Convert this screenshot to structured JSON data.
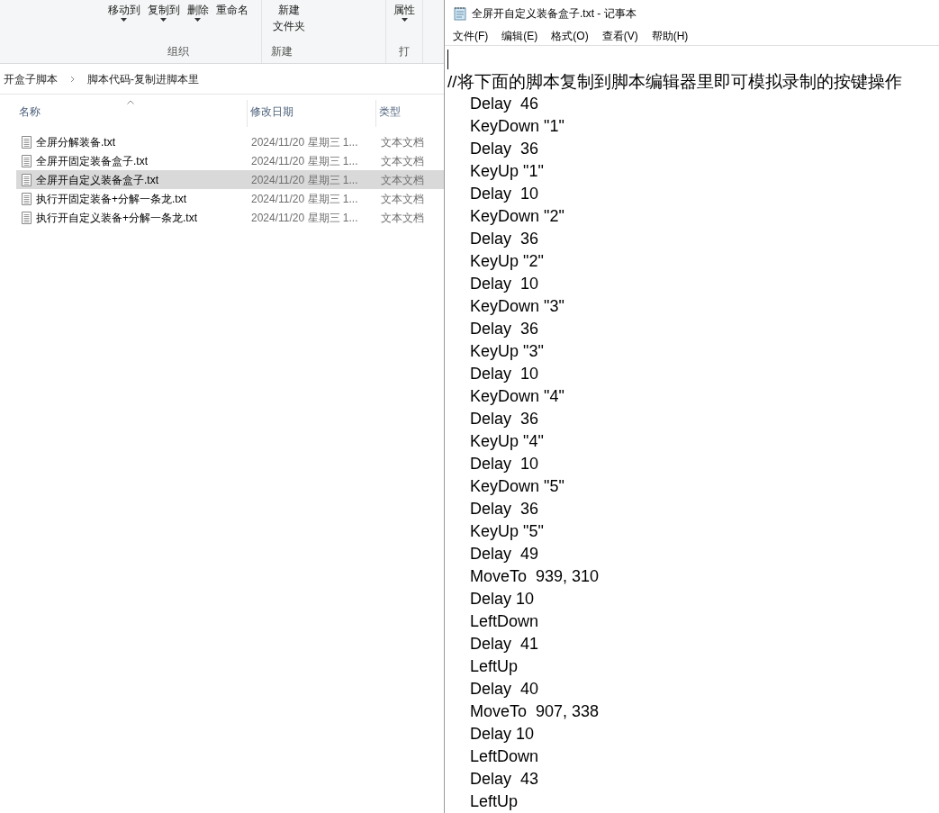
{
  "ribbon": {
    "groups": [
      {
        "label": "组织",
        "buttons": [
          {
            "label": "移动到",
            "dropdown": true
          },
          {
            "label": "复制到",
            "dropdown": true
          },
          {
            "label": "删除",
            "dropdown": true
          },
          {
            "label": "重命名",
            "dropdown": false
          }
        ]
      },
      {
        "label": "新建",
        "buttons": [
          {
            "label": [
              "新建",
              "文件夹"
            ],
            "dropdown": false
          }
        ]
      },
      {
        "label": "打",
        "buttons": [
          {
            "label": "属性",
            "dropdown": true
          }
        ]
      }
    ]
  },
  "breadcrumb": [
    "开盒子脚本",
    "脚本代码-复制进脚本里"
  ],
  "table": {
    "columns": [
      "名称",
      "修改日期",
      "类型"
    ],
    "rows": [
      {
        "name": "全屏分解装备.txt",
        "date": "2024/11/20 星期三 1...",
        "type": "文本文档",
        "selected": false
      },
      {
        "name": "全屏开固定装备盒子.txt",
        "date": "2024/11/20 星期三 1...",
        "type": "文本文档",
        "selected": false
      },
      {
        "name": "全屏开自定义装备盒子.txt",
        "date": "2024/11/20 星期三 1...",
        "type": "文本文档",
        "selected": true
      },
      {
        "name": "执行开固定装备+分解一条龙.txt",
        "date": "2024/11/20 星期三 1...",
        "type": "文本文档",
        "selected": false
      },
      {
        "name": "执行开自定义装备+分解一条龙.txt",
        "date": "2024/11/20 星期三 1...",
        "type": "文本文档",
        "selected": false
      }
    ]
  },
  "notepad": {
    "title": "全屏开自定义装备盒子.txt - 记事本",
    "menu": [
      "文件(F)",
      "编辑(E)",
      "格式(O)",
      "查看(V)",
      "帮助(H)"
    ],
    "comment": "//将下面的脚本复制到脚本编辑器里即可模拟录制的按键操作",
    "lines": [
      "Delay  46",
      "KeyDown \"1\"",
      "Delay  36",
      "KeyUp \"1\"",
      "Delay  10",
      "KeyDown \"2\"",
      "Delay  36",
      "KeyUp \"2\"",
      "Delay  10",
      "KeyDown \"3\"",
      "Delay  36",
      "KeyUp \"3\"",
      "Delay  10",
      "KeyDown \"4\"",
      "Delay  36",
      "KeyUp \"4\"",
      "Delay  10",
      "KeyDown \"5\"",
      "Delay  36",
      "KeyUp \"5\"",
      "Delay  49",
      "MoveTo  939, 310",
      "Delay 10",
      "LeftDown",
      "Delay  41",
      "LeftUp",
      "Delay  40",
      "MoveTo  907, 338",
      "Delay 10",
      "LeftDown",
      "Delay  43",
      "LeftUp"
    ]
  }
}
